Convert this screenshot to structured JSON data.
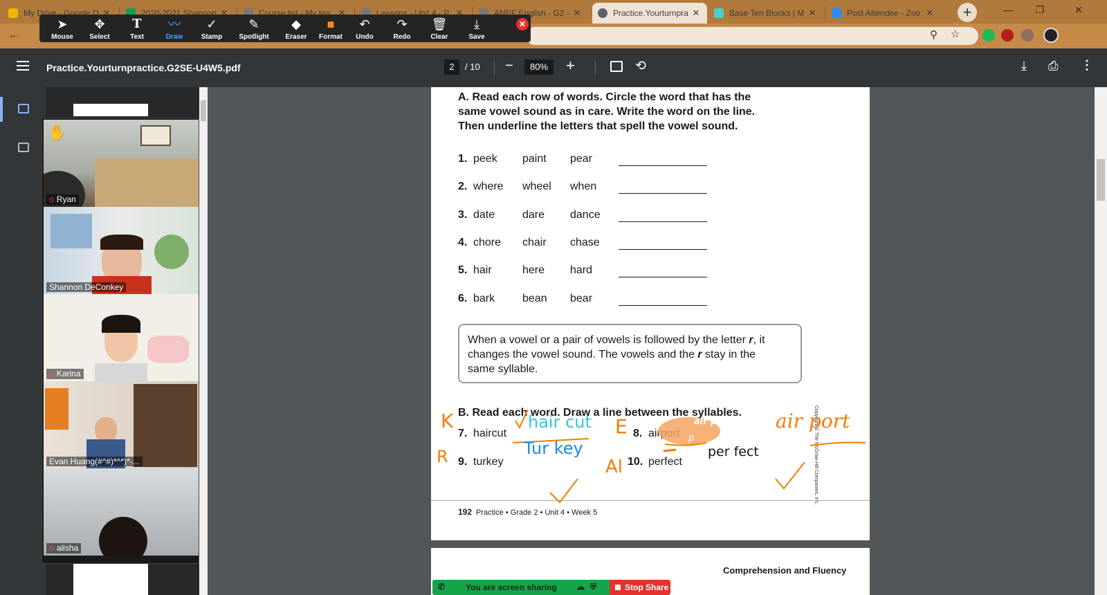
{
  "browser": {
    "tabs": [
      {
        "title": "My Drive - Google D",
        "color": "#f4b400"
      },
      {
        "title": "2020-2021 Shannon",
        "color": "#0f9d58"
      },
      {
        "title": "Course list - My tea",
        "color": "#777777"
      },
      {
        "title": "Lessons - Unit 4 - P",
        "color": "#777777"
      },
      {
        "title": "ANEF English - G2 -",
        "color": "#777777"
      },
      {
        "title": "Practice.Yourturnpra",
        "color": "#5f6368"
      },
      {
        "title": "Base Ten Blocks | M",
        "color": "#4ecdc4"
      },
      {
        "title": "Post Attendee - Zoo",
        "color": "#2d8cff"
      }
    ],
    "new_tab": "+",
    "window_buttons": [
      "—",
      "❐",
      "✕"
    ]
  },
  "zoom_toolbar": {
    "tools": [
      {
        "label": "Mouse",
        "icon": "➤"
      },
      {
        "label": "Select",
        "icon": "✥"
      },
      {
        "label": "Text",
        "icon": "T"
      },
      {
        "label": "Draw",
        "icon": "〰"
      },
      {
        "label": "Stamp",
        "icon": "✓"
      },
      {
        "label": "Spotlight",
        "icon": "✎"
      },
      {
        "label": "Eraser",
        "icon": "◆"
      },
      {
        "label": "Format",
        "icon": "■"
      },
      {
        "label": "Undo",
        "icon": "↶"
      },
      {
        "label": "Redo",
        "icon": "↷"
      },
      {
        "label": "Clear",
        "icon": "🗑"
      },
      {
        "label": "Save",
        "icon": "⤓"
      }
    ],
    "active_tool": "Draw",
    "close": "✕"
  },
  "pdf_viewer": {
    "title": "Practice.Yourturnpractice.G2SE-U4W5.pdf",
    "page_current": "2",
    "page_total": "/ 10",
    "zoom_out": "−",
    "zoom": "80%",
    "zoom_in": "+",
    "rotate": "⟲",
    "download": "⤓",
    "print": "⎙",
    "more": "⋮"
  },
  "participants": [
    {
      "name": "Ryan",
      "muted": true,
      "hand_raised": true,
      "speaking": false
    },
    {
      "name": "Shannon DeConkey",
      "muted": false,
      "hand_raised": false,
      "speaking": false
    },
    {
      "name": "Karina",
      "muted": true,
      "hand_raised": false,
      "speaking": false
    },
    {
      "name": "Evan Huang(#^#)*^*)*-...",
      "muted": false,
      "hand_raised": false,
      "speaking": true
    },
    {
      "name": "alisha",
      "muted": true,
      "hand_raised": false,
      "speaking": false
    }
  ],
  "document": {
    "section_a": {
      "instruction": [
        "A. Read each row of words. Circle the word that has the",
        "same vowel sound as in care. Write the word on the line.",
        "Then underline the letters that spell the vowel sound."
      ],
      "rows": [
        {
          "num": "1.",
          "words": [
            "peek",
            "paint",
            "pear"
          ]
        },
        {
          "num": "2.",
          "words": [
            "where",
            "wheel",
            "when"
          ]
        },
        {
          "num": "3.",
          "words": [
            "date",
            "dare",
            "dance"
          ]
        },
        {
          "num": "4.",
          "words": [
            "chore",
            "chair",
            "chase"
          ]
        },
        {
          "num": "5.",
          "words": [
            "hair",
            "here",
            "hard"
          ]
        },
        {
          "num": "6.",
          "words": [
            "bark",
            "bean",
            "bear"
          ]
        }
      ]
    },
    "rule_box": {
      "line1_pre": "When a vowel or a pair of vowels is followed by the letter ",
      "letter": "r",
      "line1_post": ", it",
      "line2_pre": "changes the vowel sound. The vowels and the ",
      "line2_post": " stay in the",
      "line3": "same syllable."
    },
    "section_b": {
      "instruction": "B. Read each word. Draw a line between the syllables.",
      "items": [
        {
          "num": "7.",
          "word": "haircut"
        },
        {
          "num": "8.",
          "word": "airport"
        },
        {
          "num": "9.",
          "word": "turkey"
        },
        {
          "num": "10.",
          "word": "perfect"
        }
      ]
    },
    "copyright": "Copyright © The McGraw-Hill Companies, Inc.",
    "footer_page": "192",
    "footer_text": "Practice • Grade 2 • Unit 4 • Week 5",
    "next_page_heading": "Comprehension and Fluency"
  },
  "annotations": {
    "k": "K",
    "haircut_typed": "hair  cut",
    "e": "E",
    "airplane_typed": "air plane",
    "p_typed": "p",
    "airport_hand": "air port",
    "r": "R",
    "turkey_typed": "Tur  key",
    "al": "Al",
    "perfect_typed": "per fect",
    "colors": {
      "orange": "#f57c00",
      "cyan": "#39c4e0",
      "blue": "#1e88e5",
      "highlight": "#f4a460"
    }
  },
  "share": {
    "status": "You are screen sharing",
    "stop": "Stop Share"
  }
}
